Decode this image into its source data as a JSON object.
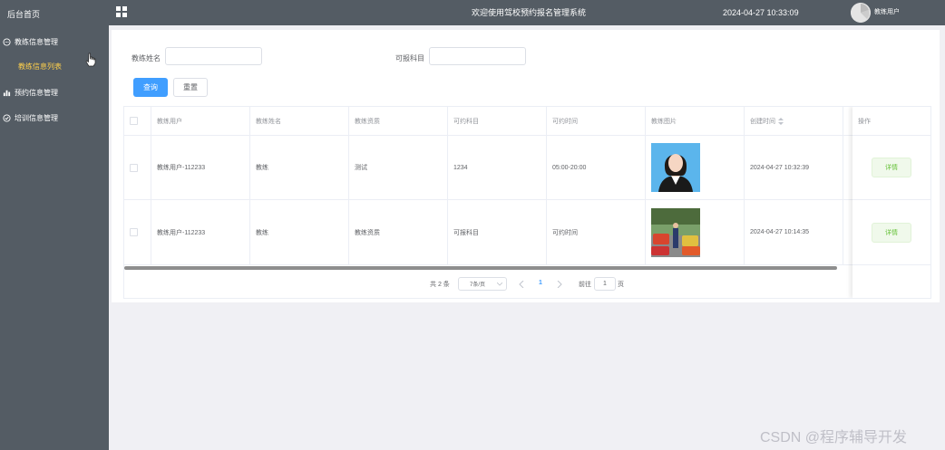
{
  "sidebar": {
    "home": "后台首页",
    "groups": [
      {
        "label": "教练信息管理",
        "sub": "教练信息列表"
      },
      {
        "label": "预约信息管理"
      },
      {
        "label": "培训信息管理"
      }
    ]
  },
  "header": {
    "title": "欢迎使用驾校预约报名管理系统",
    "datetime": "2024-04-27 10:33:09",
    "user": "教练用户"
  },
  "filters": {
    "coach_name_label": "教练姓名",
    "subject_label": "可报科目",
    "coach_name_value": "",
    "subject_value": "",
    "search_label": "查询",
    "reset_label": "重置"
  },
  "table": {
    "headers": [
      "教练用户",
      "教练姓名",
      "教练资质",
      "可约科目",
      "可约时间",
      "教练图片",
      "创建时间",
      "操作"
    ],
    "rows": [
      {
        "user": "教练用户-112233",
        "name": "教练",
        "qualification": "测试",
        "subject": "1234",
        "time": "05:00-20:00",
        "created": "2024-04-27 10:32:39",
        "action": "详情"
      },
      {
        "user": "教练用户-112233",
        "name": "教练",
        "qualification": "教练资质",
        "subject": "可报科目",
        "time": "可约时间",
        "created": "2024-04-27 10:14:35",
        "action": "详情"
      }
    ]
  },
  "pagination": {
    "total": "共 2 条",
    "page_size": "7条/页",
    "current_page": "1",
    "goto_label": "前往",
    "goto_value": "1",
    "page_suffix": "页"
  },
  "watermark": "CSDN @程序辅导开发",
  "colors": {
    "sidebar": "#545c64",
    "primary": "#409eff",
    "active_sub": "#ffd04b",
    "success": "#67c23a"
  }
}
